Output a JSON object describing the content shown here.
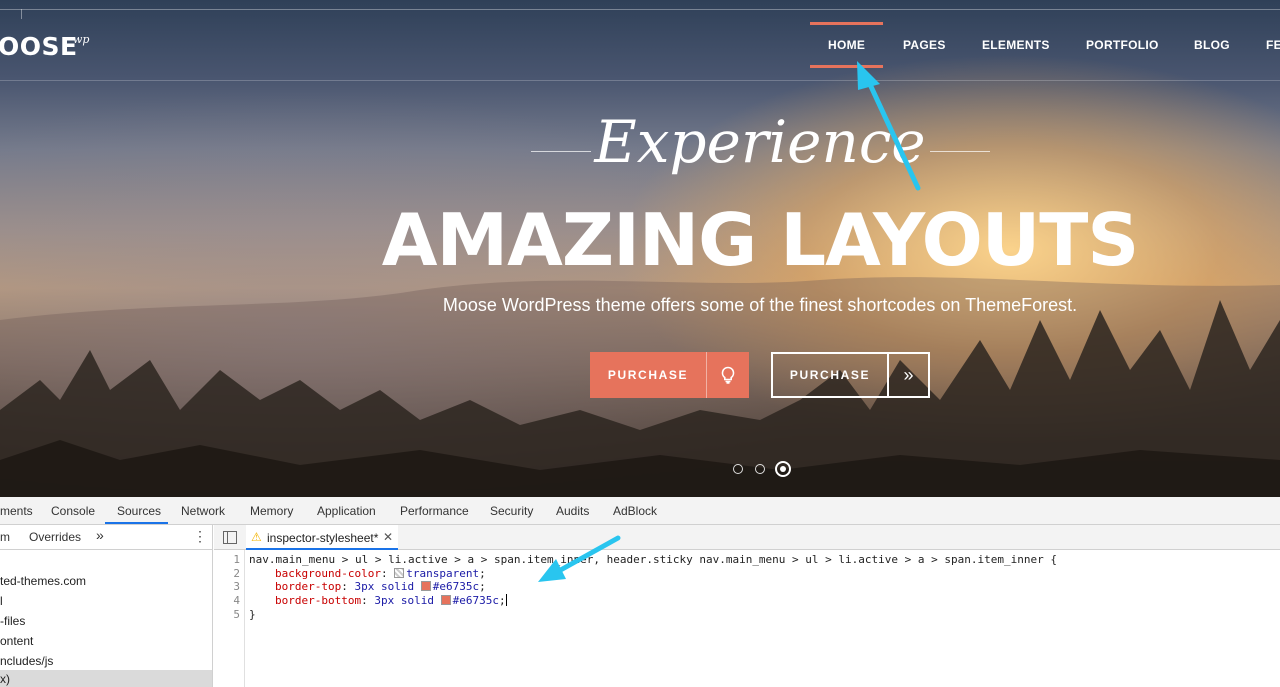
{
  "site": {
    "logo_text": "OOSE",
    "logo_suffix": "wp",
    "nav_items": [
      "HOME",
      "PAGES",
      "ELEMENTS",
      "PORTFOLIO",
      "BLOG",
      "FE"
    ],
    "active_nav": "HOME"
  },
  "hero": {
    "script_title": "Experience",
    "headline": "AMAZING LAYOUTS",
    "subtitle": "Moose WordPress theme offers some of the finest shortcodes on ThemeForest.",
    "buttons": [
      {
        "label": "PURCHASE",
        "icon": "lightbulb-icon"
      },
      {
        "label": "PURCHASE",
        "icon": "double-chevron-right-icon",
        "glyph": "»"
      }
    ],
    "slider": {
      "count": 3,
      "active_index": 3
    }
  },
  "devtools": {
    "tabs": [
      "ments",
      "Console",
      "Sources",
      "Network",
      "Memory",
      "Application",
      "Performance",
      "Security",
      "Audits",
      "AdBlock"
    ],
    "active_tab": "Sources",
    "navigator": {
      "tabs": [
        "m",
        "Overrides"
      ],
      "more": "»",
      "menu": "⋮",
      "tree": [
        "ted-themes.com",
        "l",
        "-files",
        "ontent",
        "ncludes/js",
        "x)"
      ]
    },
    "editor": {
      "file_tab": "inspector-stylesheet*",
      "close_glyph": "✕",
      "line_numbers": [
        "1",
        "2",
        "3",
        "4",
        "5"
      ],
      "lines": {
        "selector": "nav.main_menu > ul > li.active > a > span.item_inner, header.sticky nav.main_menu > ul > li.active > a > span.item_inner {",
        "l2_prop": "background-color",
        "l2_val": "transparent",
        "l3_prop": "border-top",
        "l3_val": "3px solid",
        "l3_color": "#e6735c",
        "l4_prop": "border-bottom",
        "l4_val": "3px solid",
        "l4_color": "#e6735c",
        "closing": "}"
      }
    }
  },
  "colors": {
    "accent": "#e6735c",
    "annotation_arrow": "#29c5ef",
    "devtools_active": "#1a73e8"
  }
}
